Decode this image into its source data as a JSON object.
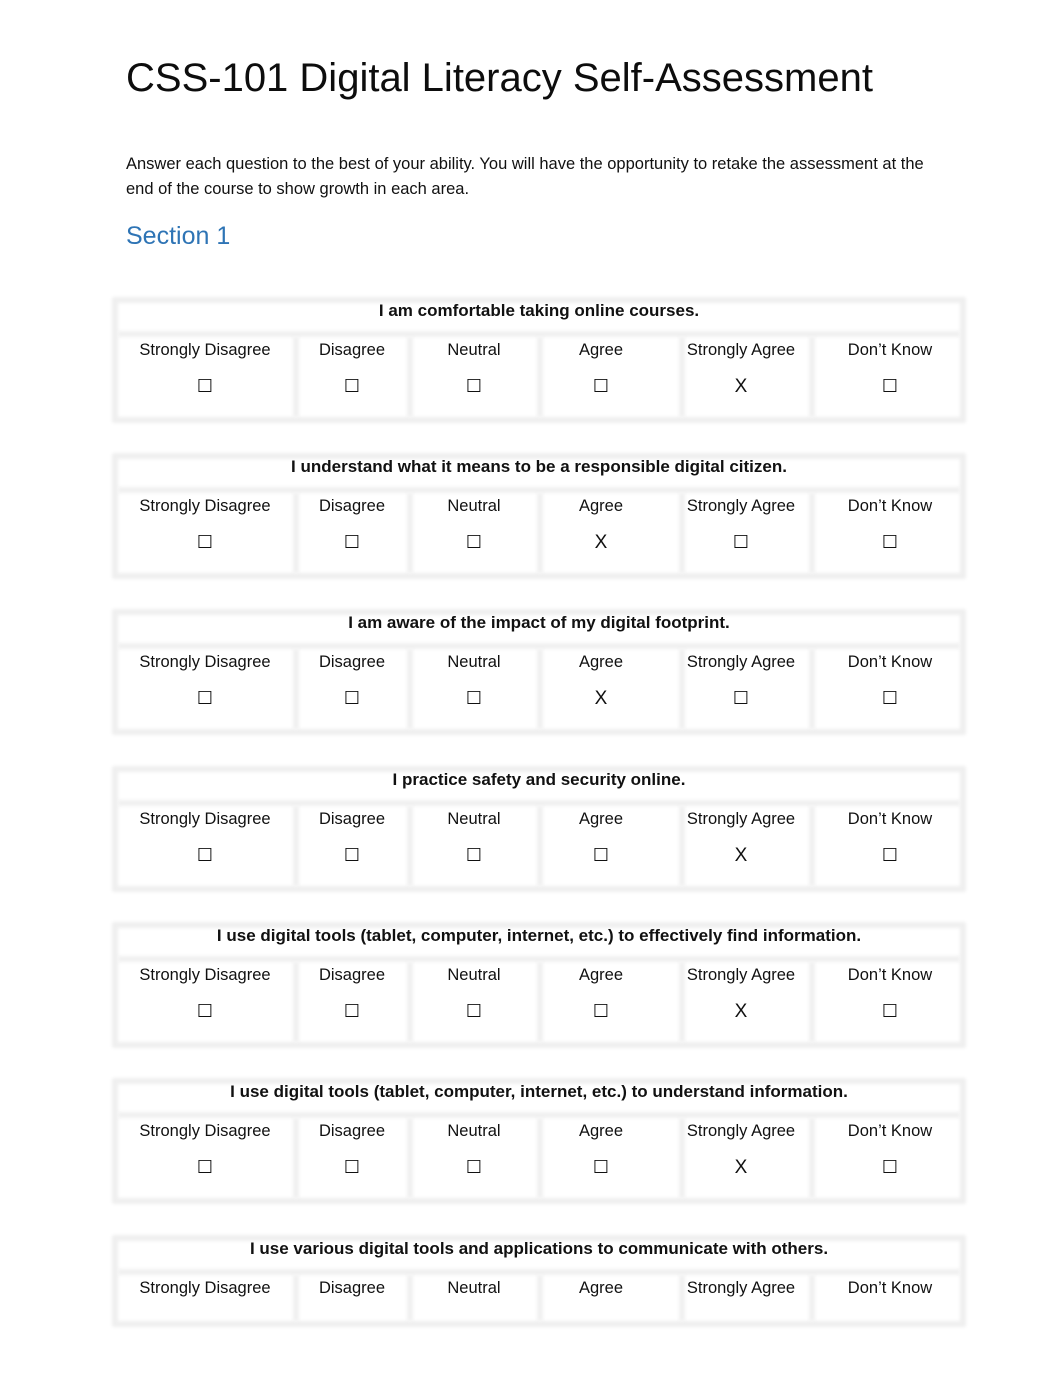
{
  "document": {
    "title": "CSS-101 Digital Literacy Self-Assessment",
    "intro": "Answer each question to the best of your ability.  You will have the opportunity to retake the assessment at the end of the course to show growth in each area.",
    "section_heading": "Section 1",
    "section_color": "#2e74b5"
  },
  "scale_options": [
    "Strongly Disagree",
    "Disagree",
    "Neutral",
    "Agree",
    "Strongly Agree",
    "Don’t Know"
  ],
  "unchecked_glyph": "☐",
  "checked_glyph": "X",
  "questions": [
    {
      "text": "I am comfortable taking online courses.",
      "selected": "Strongly Agree",
      "marks": [
        "☐",
        "☐",
        "☐",
        "☐",
        "X",
        "☐"
      ]
    },
    {
      "text": "I understand what it means to be a responsible digital citizen.",
      "selected": "Agree",
      "marks": [
        "☐",
        "☐",
        "☐",
        "X",
        "☐",
        "☐"
      ]
    },
    {
      "text": "I am aware of the impact of my digital footprint.",
      "selected": "Agree",
      "marks": [
        "☐",
        "☐",
        "☐",
        "X",
        "☐",
        "☐"
      ]
    },
    {
      "text": "I practice safety and security online.",
      "selected": "Strongly Agree",
      "marks": [
        "☐",
        "☐",
        "☐",
        "☐",
        "X",
        "☐"
      ]
    },
    {
      "text": "I use digital tools (tablet, computer, internet, etc.) to effectively find information.",
      "selected": "Strongly Agree",
      "marks": [
        "☐",
        "☐",
        "☐",
        "☐",
        "X",
        "☐"
      ]
    },
    {
      "text": "I use digital tools (tablet, computer, internet, etc.) to understand information.",
      "selected": "Strongly Agree",
      "marks": [
        "☐",
        "☐",
        "☐",
        "☐",
        "X",
        "☐"
      ]
    },
    {
      "text": "I use various digital tools and applications to communicate with others.",
      "selected": null,
      "marks": [
        "",
        "",
        "",
        "",
        "",
        ""
      ]
    }
  ]
}
